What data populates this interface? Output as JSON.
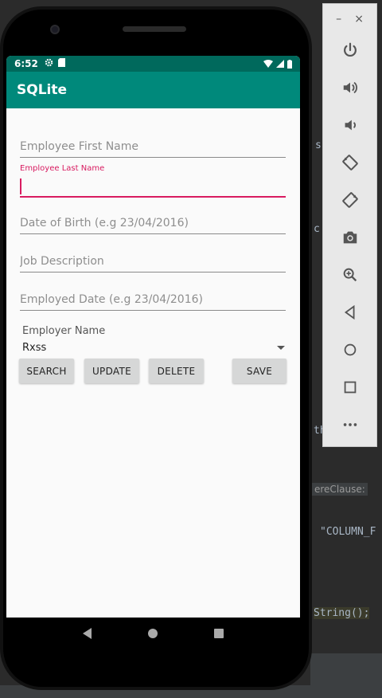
{
  "status_bar": {
    "time": "6:52"
  },
  "app_bar": {
    "title": "SQLite"
  },
  "form": {
    "first_name_placeholder": "Employee First Name",
    "last_name_label": "Employee Last Name",
    "last_name_value": "",
    "dob_placeholder": "Date of Birth (e.g 23/04/2016)",
    "job_placeholder": "Job Description",
    "employed_placeholder": "Employed Date (e.g 23/04/2016)",
    "employer_label": "Employer Name",
    "employer_value": "Rxss"
  },
  "buttons": {
    "search": "SEARCH",
    "update": "UPDATE",
    "delete": "DELETE",
    "save": "SAVE"
  },
  "emulator_panel": {
    "minimize": "–",
    "close": "×",
    "tools": [
      "power-icon",
      "volume-up-icon",
      "volume-down-icon",
      "rotate-left-icon",
      "rotate-right-icon",
      "camera-icon",
      "zoom-icon",
      "back-icon",
      "home-icon",
      "overview-icon",
      "more-icon"
    ]
  },
  "ide": {
    "frag_where_clause": "ereClause:",
    "frag_column": "\"COLUMN_F",
    "frag_tostring": "String();",
    "frag_s": "s",
    "frag_th": "th",
    "frag_c": "c",
    "frag_e": "e",
    "frag_r": "r"
  },
  "colors": {
    "primary": "#00897b",
    "primary_dark": "#00695c",
    "accent": "#d81b60",
    "button": "#d6d7d7"
  }
}
